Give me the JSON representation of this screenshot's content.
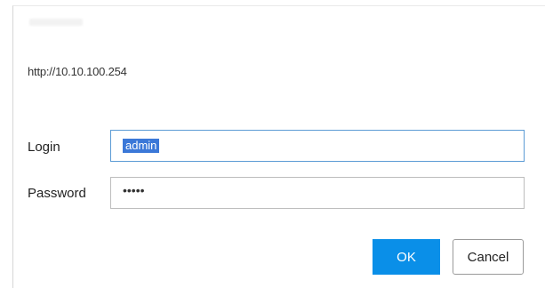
{
  "dialog": {
    "url": "http://10.10.100.254",
    "login": {
      "label": "Login",
      "value": "admin"
    },
    "password": {
      "label": "Password",
      "masked_value": "•••••"
    },
    "ok_label": "OK",
    "cancel_label": "Cancel"
  }
}
